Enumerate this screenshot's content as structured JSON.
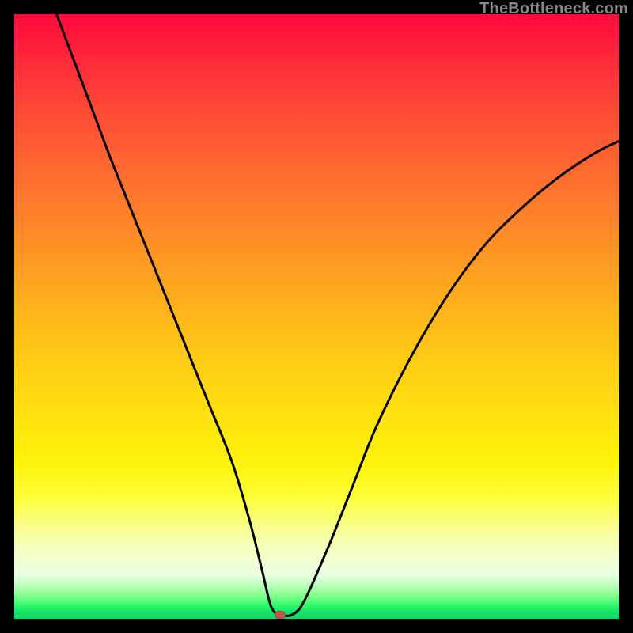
{
  "watermark": "TheBottleneck.com",
  "marker": {
    "x_pct": 44.0,
    "y_pct": 99.3
  },
  "colors": {
    "curve_stroke": "#000000",
    "marker_fill": "#c05048"
  },
  "chart_data": {
    "type": "line",
    "title": "",
    "xlabel": "",
    "ylabel": "",
    "xlim": [
      0,
      100
    ],
    "ylim": [
      0,
      100
    ],
    "grid": false,
    "legend": false,
    "annotations": [
      {
        "type": "marker",
        "x": 44,
        "y": 0.7,
        "shape": "rounded-rect",
        "color": "#c05048"
      }
    ],
    "series": [
      {
        "name": "bottleneck-curve",
        "x": [
          7,
          10,
          13,
          16,
          20,
          24,
          28,
          32,
          36,
          39,
          41,
          42.5,
          44,
          46,
          48,
          52,
          56,
          60,
          66,
          72,
          78,
          84,
          90,
          96,
          100
        ],
        "y": [
          100,
          92,
          84,
          76,
          66,
          56,
          46,
          36,
          26,
          16,
          8,
          2,
          0.7,
          0.7,
          3,
          12,
          22,
          32,
          44,
          54,
          62,
          68,
          73,
          77,
          79
        ]
      }
    ]
  }
}
